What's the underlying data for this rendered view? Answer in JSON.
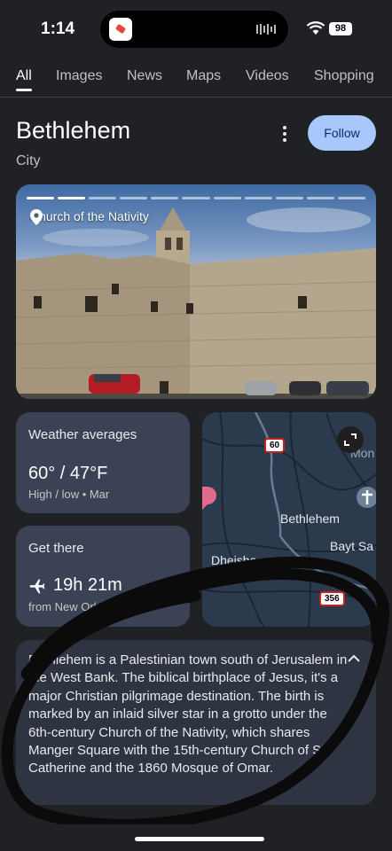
{
  "status_bar": {
    "time": "1:14",
    "battery": "98"
  },
  "tabs": [
    {
      "label": "All",
      "active": true
    },
    {
      "label": "Images"
    },
    {
      "label": "News"
    },
    {
      "label": "Maps"
    },
    {
      "label": "Videos"
    },
    {
      "label": "Shopping"
    }
  ],
  "entity": {
    "title": "Bethlehem",
    "subtitle": "City",
    "follow_label": "Follow"
  },
  "photo": {
    "location_label": "Church of the Nativity",
    "progress_segments": 11,
    "progress_done": 2
  },
  "weather": {
    "heading": "Weather averages",
    "value": "60° / 47°F",
    "detail": "High / low • Mar"
  },
  "get_there": {
    "heading": "Get there",
    "time": "19h 21m",
    "detail": "from New Orleans"
  },
  "map": {
    "city_label": "Bethlehem",
    "label_bayt": "Bayt Sa",
    "label_dheisha": "Dheisha",
    "label_mon": "Mon",
    "route_60": "60",
    "route_356": "356"
  },
  "description": {
    "text": "Bethlehem is a Palestinian town south of Jerusalem in the West Bank. The biblical birthplace of Jesus, it's a major Christian pilgrimage destination. The birth is marked by an inlaid silver star in a grotto under the 6th-century Church of the Nativity, which shares Manger Square with the 15th-century Church of St. Catherine and the 1860 Mosque of Omar."
  },
  "colors": {
    "accent_button": "#a8c7fa",
    "card": "#3c4256",
    "background": "#202124"
  }
}
